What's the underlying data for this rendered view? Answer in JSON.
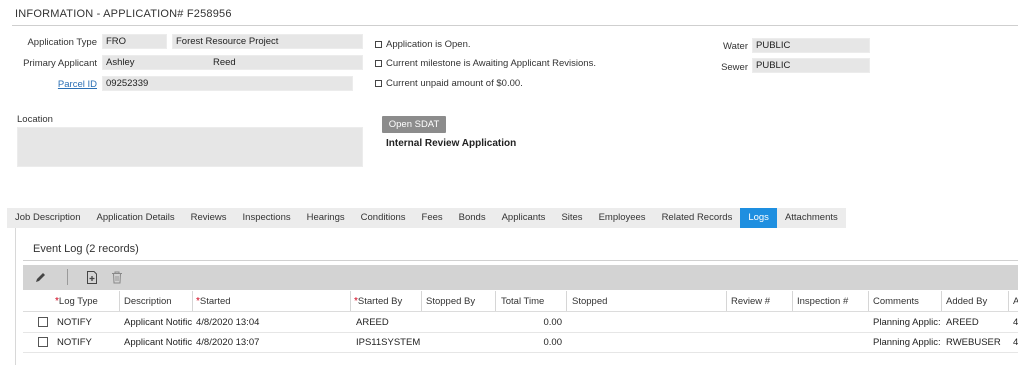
{
  "header": {
    "title": "INFORMATION - APPLICATION# F258956"
  },
  "info": {
    "application_type_label": "Application Type",
    "application_type_code": "FRO",
    "application_type_name": "Forest Resource Project",
    "primary_applicant_label": "Primary Applicant",
    "applicant_first": "Ashley",
    "applicant_last": "Reed",
    "parcel_label": "Parcel ID",
    "parcel_value": "09252339",
    "location_label": "Location",
    "location_value": ""
  },
  "status": {
    "lines": [
      "Application is Open.",
      "Current milestone is Awaiting Applicant Revisions.",
      "Current unpaid amount of $0.00."
    ]
  },
  "utilities": {
    "water_label": "Water",
    "water_value": "PUBLIC",
    "sewer_label": "Sewer",
    "sewer_value": "PUBLIC"
  },
  "actions": {
    "open_sdat": "Open SDAT",
    "internal_review": "Internal Review Application"
  },
  "tabs": [
    {
      "label": "Job Description",
      "active": false
    },
    {
      "label": "Application Details",
      "active": false
    },
    {
      "label": "Reviews",
      "active": false
    },
    {
      "label": "Inspections",
      "active": false
    },
    {
      "label": "Hearings",
      "active": false
    },
    {
      "label": "Conditions",
      "active": false
    },
    {
      "label": "Fees",
      "active": false
    },
    {
      "label": "Bonds",
      "active": false
    },
    {
      "label": "Applicants",
      "active": false
    },
    {
      "label": "Sites",
      "active": false
    },
    {
      "label": "Employees",
      "active": false
    },
    {
      "label": "Related Records",
      "active": false
    },
    {
      "label": "Logs",
      "active": true
    },
    {
      "label": "Attachments",
      "active": false
    }
  ],
  "event_log": {
    "title": "Event Log (2 records)",
    "toolbar_icons": [
      "pencil-icon",
      "add-document-icon",
      "trash-icon"
    ],
    "columns": [
      {
        "label": "Log Type",
        "required": true
      },
      {
        "label": "Description",
        "required": false
      },
      {
        "label": "Started",
        "required": true
      },
      {
        "label": "Started By",
        "required": true
      },
      {
        "label": "Stopped By",
        "required": false
      },
      {
        "label": "Total Time",
        "required": false
      },
      {
        "label": "Stopped",
        "required": false
      },
      {
        "label": "Review #",
        "required": false
      },
      {
        "label": "Inspection #",
        "required": false
      },
      {
        "label": "Comments",
        "required": false
      },
      {
        "label": "Added By",
        "required": false
      },
      {
        "label": "A",
        "required": false
      }
    ],
    "rows": [
      {
        "log_type": "NOTIFY",
        "description": "Applicant Notific",
        "started": "4/8/2020 13:04",
        "started_by": "AREED",
        "stopped_by": "",
        "total_time": "0.00",
        "stopped": "",
        "review": "",
        "inspection": "",
        "comments": "Planning Applic:",
        "added_by": "AREED",
        "extra": "4"
      },
      {
        "log_type": "NOTIFY",
        "description": "Applicant Notific",
        "started": "4/8/2020 13:07",
        "started_by": "IPS11SYSTEM",
        "stopped_by": "",
        "total_time": "0.00",
        "stopped": "",
        "review": "",
        "inspection": "",
        "comments": "Planning Applic:",
        "added_by": "RWEBUSER",
        "extra": "4"
      }
    ]
  },
  "colors": {
    "active_tab": "#1e8fe0",
    "field_bg": "#e6e6e6",
    "toolbar_bg": "#d3d3d3",
    "button_bg": "#8c8c8c",
    "required_star": "#d0021b",
    "link": "#2a6fb5"
  }
}
